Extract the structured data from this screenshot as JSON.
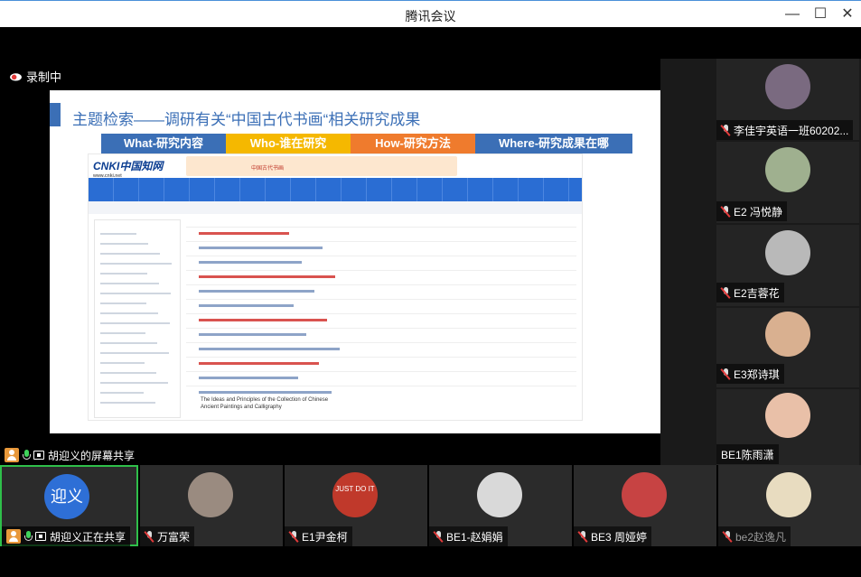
{
  "window": {
    "title": "腾讯会议",
    "minimize": "—",
    "maximize": "☐",
    "close": "✕"
  },
  "recording": {
    "label": "录制中"
  },
  "share": {
    "presenter_label": "胡迎义的屏幕共享",
    "slide_title": "主题检索——调研有关“中国古代书画“相关研究成果",
    "tags": [
      {
        "label": "What-研究内容",
        "color": "#3b6fb6"
      },
      {
        "label": "Who-谁在研究",
        "color": "#f5b800"
      },
      {
        "label": "How-研究方法",
        "color": "#ef7b2d"
      },
      {
        "label": "Where-研究成果在哪",
        "color": "#3b6fb6"
      }
    ],
    "cnki_logo": "CNKI中国知网",
    "cnki_site": "www.cnki.net",
    "cnki_search_text": "中国古代书画",
    "cnki_last_title": "The Ideas and Principles of the Collection of Chinese Ancient Paintings and Calligraphy"
  },
  "right_participants": [
    {
      "name": "李佳宇英语一班60202...",
      "avatar_color": "#7a6a80",
      "muted": true
    },
    {
      "name": "E2 冯悦静",
      "avatar_color": "#9fb08f",
      "muted": true
    },
    {
      "name": "E2吉蓉花",
      "avatar_color": "#b9b9b9",
      "muted": true
    },
    {
      "name": "E3郑诗琪",
      "avatar_color": "#d9b090",
      "muted": true
    },
    {
      "name": "BE1陈雨潇",
      "avatar_color": "#e9c0a8",
      "muted": false
    }
  ],
  "bottom_participants": [
    {
      "name": "胡迎义正在共享",
      "avatar_text": "迎义",
      "avatar_color": "#2e6fd6",
      "sharing": true
    },
    {
      "name": "万富荣",
      "avatar_color": "#9a8b80",
      "muted": true
    },
    {
      "name": "E1尹金柯",
      "avatar_text": "JUST DO IT",
      "avatar_color": "#c0392b",
      "muted": true
    },
    {
      "name": "BE1-赵娟娟",
      "avatar_color": "#d9d9d9",
      "muted": true
    },
    {
      "name": "BE3 周娅婷",
      "avatar_color": "#c74343",
      "muted": true
    },
    {
      "name": "be2赵逸凡",
      "avatar_color": "#e8dcc0",
      "muted": true
    }
  ]
}
